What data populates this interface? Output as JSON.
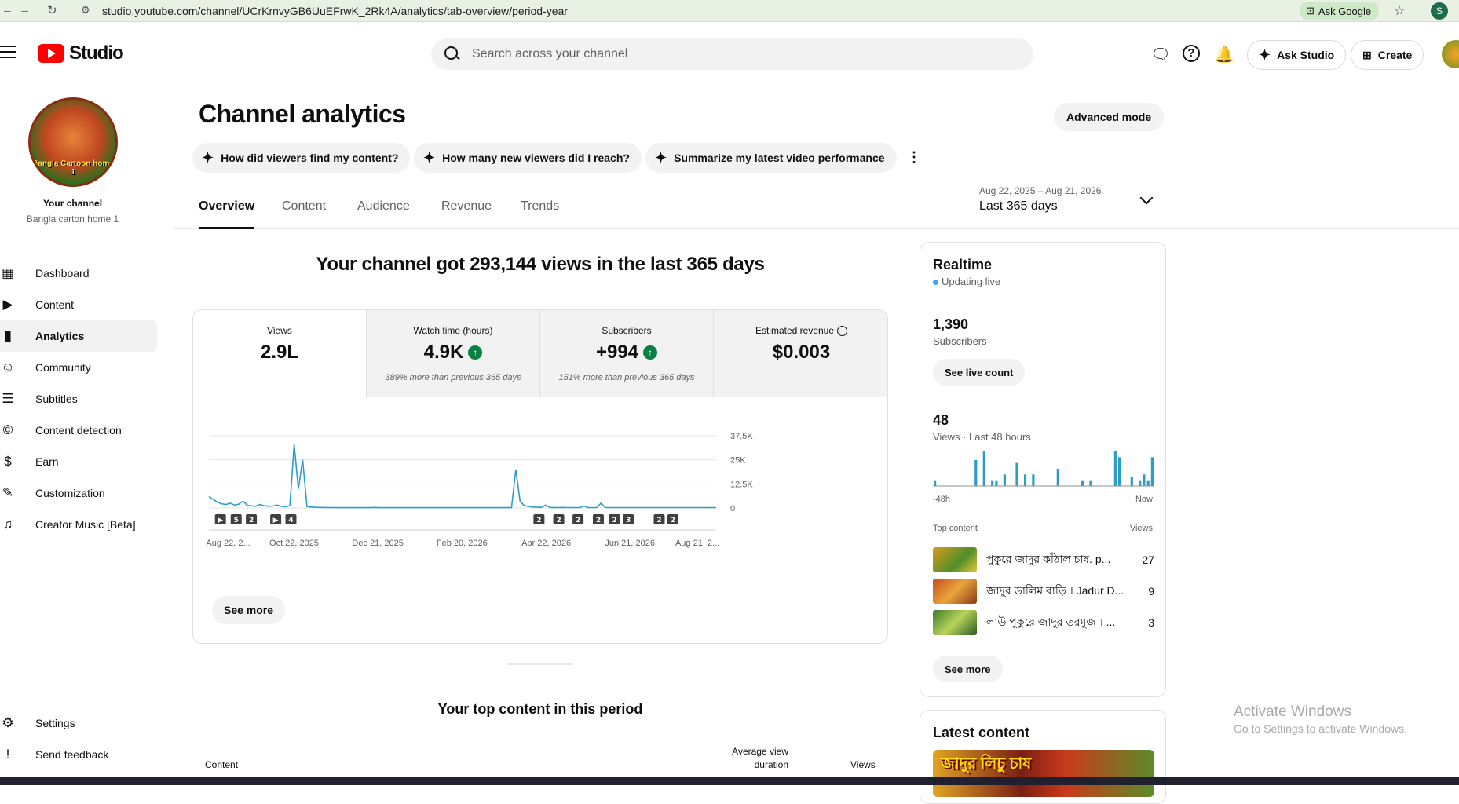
{
  "browser": {
    "url": "studio.youtube.com/channel/UCrKrnvyGB6UuEFrwK_2Rk4A/analytics/tab-overview/period-year",
    "ask_google": "Ask Google",
    "profile_initial": "S"
  },
  "header": {
    "logo_text": "Studio",
    "search_placeholder": "Search across your channel",
    "ask_studio": "Ask Studio",
    "create": "Create"
  },
  "sidebar": {
    "channel_avatar_text": "Bangla Cartoon home 1",
    "your_channel": "Your channel",
    "channel_name": "Bangla carton home 1",
    "items": [
      {
        "label": "Dashboard",
        "icon": "dashboard-icon"
      },
      {
        "label": "Content",
        "icon": "content-icon"
      },
      {
        "label": "Analytics",
        "icon": "analytics-icon"
      },
      {
        "label": "Community",
        "icon": "community-icon"
      },
      {
        "label": "Subtitles",
        "icon": "subtitles-icon"
      },
      {
        "label": "Content detection",
        "icon": "copyright-icon"
      },
      {
        "label": "Earn",
        "icon": "dollar-icon"
      },
      {
        "label": "Customization",
        "icon": "magic-wand-icon"
      },
      {
        "label": "Creator Music [Beta]",
        "icon": "music-library-icon"
      }
    ],
    "settings": "Settings",
    "feedback": "Send feedback"
  },
  "page": {
    "title": "Channel analytics",
    "advanced_mode": "Advanced mode",
    "chips": [
      "How did viewers find my content?",
      "How many new viewers did I reach?",
      "Summarize my latest video performance"
    ],
    "tabs": [
      "Overview",
      "Content",
      "Audience",
      "Revenue",
      "Trends"
    ],
    "date_range": "Aug 22, 2025 – Aug 21, 2026",
    "date_label": "Last 365 days",
    "headline": "Your channel got 293,144 views in the last 365 days"
  },
  "metrics": [
    {
      "label": "Views",
      "value": "2.9L",
      "compare": ""
    },
    {
      "label": "Watch time (hours)",
      "value": "4.9K",
      "compare": "389% more than previous 365 days"
    },
    {
      "label": "Subscribers",
      "value": "+994",
      "compare": "151% more than previous 365 days"
    },
    {
      "label": "Estimated revenue",
      "value": "$0.003",
      "compare": ""
    }
  ],
  "chart_data": {
    "type": "line",
    "x": [
      "Aug 22, 2...",
      "Oct 22, 2025",
      "Dec 21, 2025",
      "Feb 20, 2026",
      "Apr 22, 2026",
      "Jun 21, 2026",
      "Aug 21, 2..."
    ],
    "y_ticks": [
      "37.5K",
      "25K",
      "12.5K",
      "0"
    ],
    "ylim": [
      0,
      37500
    ],
    "series": [
      {
        "values": [
          6000,
          4500,
          3000,
          2200,
          1800,
          2500,
          1500,
          2000,
          3500,
          1400,
          1100,
          900,
          1800,
          1200,
          900,
          1000,
          1500,
          900,
          700,
          1200,
          33000,
          10000,
          25000,
          800,
          500,
          400,
          300,
          300,
          200,
          200,
          200,
          150,
          150,
          150,
          150,
          150,
          150,
          150,
          150,
          300,
          150,
          150,
          150,
          150,
          150,
          150,
          150,
          150,
          150,
          150,
          150,
          150,
          150,
          150,
          150,
          150,
          150,
          150,
          150,
          150,
          150,
          150,
          150,
          200,
          150,
          150,
          150,
          150,
          150,
          150,
          150,
          150,
          20000,
          3500,
          1200,
          800,
          500,
          400,
          300,
          1500,
          300,
          250,
          200,
          300,
          200,
          200,
          200,
          200,
          1000,
          200,
          200,
          200,
          2500,
          250,
          200,
          200,
          200,
          200,
          200,
          200,
          200,
          200,
          200,
          200,
          200,
          200,
          200,
          200,
          200,
          200,
          200,
          200,
          200,
          200,
          200,
          200,
          200,
          200,
          200,
          200
        ]
      }
    ],
    "markers": [
      {
        "label": "▶",
        "kind": "video"
      },
      {
        "label": "5",
        "kind": "count"
      },
      {
        "label": "2",
        "kind": "count"
      },
      {
        "label": "▶",
        "kind": "video"
      },
      {
        "label": "4",
        "kind": "count"
      },
      {
        "label": "2",
        "kind": "count"
      },
      {
        "label": "2",
        "kind": "count"
      },
      {
        "label": "2",
        "kind": "count"
      },
      {
        "label": "2",
        "kind": "count"
      },
      {
        "label": "2",
        "kind": "count"
      },
      {
        "label": "3",
        "kind": "count"
      },
      {
        "label": "2",
        "kind": "count"
      },
      {
        "label": "2",
        "kind": "count"
      }
    ],
    "line_color": "#2c9cc8"
  },
  "see_more": "See more",
  "top_content": {
    "title": "Your top content in this period",
    "col_content": "Content",
    "col_avd": "Average view duration",
    "col_views": "Views"
  },
  "realtime": {
    "title": "Realtime",
    "updating": "Updating live",
    "subs_value": "1,390",
    "subs_label": "Subscribers",
    "see_live": "See live count",
    "views_value": "48",
    "views_label": "Views · Last 48 hours",
    "bars": [
      2,
      0,
      0,
      0,
      0,
      0,
      0,
      0,
      0,
      0,
      9,
      0,
      12,
      0,
      2,
      2,
      0,
      4,
      0,
      0,
      8,
      0,
      4,
      0,
      4,
      0,
      0,
      0,
      0,
      0,
      6,
      0,
      0,
      0,
      0,
      0,
      2,
      0,
      2,
      0,
      0,
      0,
      0,
      0,
      12,
      10,
      0,
      0,
      3,
      0,
      2,
      4,
      2,
      10
    ],
    "axis_left": "-48h",
    "axis_right": "Now",
    "top_content_label": "Top content",
    "views_col": "Views",
    "items": [
      {
        "title": "পুকুরে জাদুর কাঁঠাল চাষ. p...",
        "views": "27"
      },
      {
        "title": "জাদুর ডালিম বাড়ি । Jadur D...",
        "views": "9"
      },
      {
        "title": "লাউ পুকুরে জাদুর তরমুজ । ...",
        "views": "3"
      }
    ],
    "see_more": "See more"
  },
  "latest": {
    "title": "Latest content",
    "thumb_text": "জাদুর লিচু চাষ"
  },
  "watermark": {
    "line1": "Activate Windows",
    "line2": "Go to Settings to activate Windows."
  }
}
